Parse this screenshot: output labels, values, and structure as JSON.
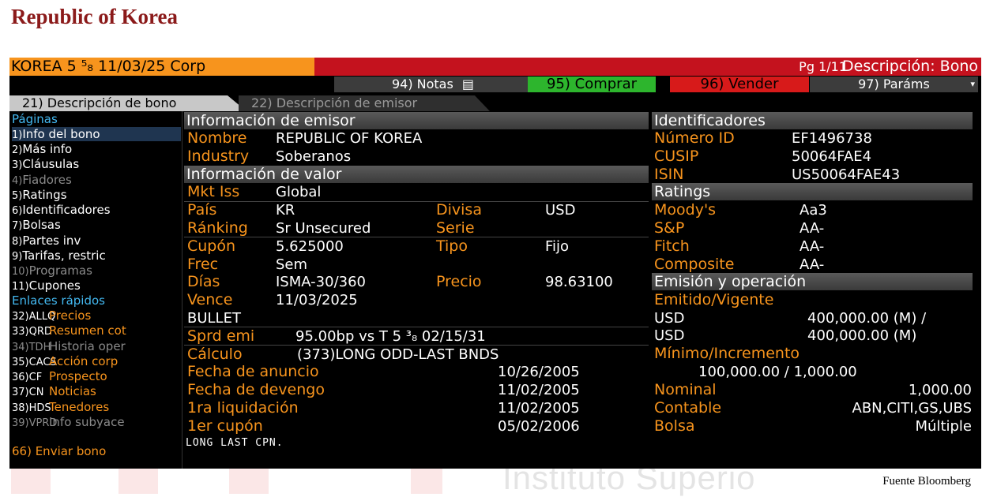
{
  "slide": {
    "title": "Republic of Korea",
    "source": "Fuente Bloomberg",
    "watermark": "Instituto Superio"
  },
  "header": {
    "security": "KOREA 5 ⁵₈ 11/03/25 Corp",
    "page": "Pg 1/11",
    "screen_title": "Descripción: Bono",
    "colors": {
      "orange": "#f7941d",
      "red_bar": "#c4121e",
      "green": "#2db52d",
      "sell_red": "#d71a1a"
    }
  },
  "toolbar": {
    "notes": "94) Notas",
    "buy": "95) Comprar",
    "sell": "96) Vender",
    "params": "97) Paráms",
    "params_arrow": "▾",
    "notes_icon": "document-icon"
  },
  "tabs": [
    {
      "label": "21) Descripción de bono"
    },
    {
      "label": "22) Descripción de emisor"
    }
  ],
  "sidebar": {
    "pages_heading": "Páginas",
    "pages": [
      {
        "num": "1)",
        "label": "Info del bono"
      },
      {
        "num": "2)",
        "label": "Más info"
      },
      {
        "num": "3)",
        "label": "Cláusulas"
      },
      {
        "num": "4)",
        "label": "Fiadores"
      },
      {
        "num": "5)",
        "label": "Ratings"
      },
      {
        "num": "6)",
        "label": "Identificadores"
      },
      {
        "num": "7)",
        "label": "Bolsas"
      },
      {
        "num": "8)",
        "label": "Partes inv"
      },
      {
        "num": "9)",
        "label": "Tarifas, restric"
      },
      {
        "num": "10)",
        "label": "Programas"
      },
      {
        "num": "11)",
        "label": "Cupones"
      }
    ],
    "links_heading": "Enlaces rápidos",
    "links": [
      {
        "code": "32)ALLQ",
        "label": "Precios"
      },
      {
        "code": "33)QRD",
        "label": "Resumen cot"
      },
      {
        "code": "34)TDH",
        "label": "Historia oper"
      },
      {
        "code": "35)CACS",
        "label": "Acción corp"
      },
      {
        "code": "36)CF",
        "label": "Prospecto"
      },
      {
        "code": "37)CN",
        "label": "Noticias"
      },
      {
        "code": "38)HDS",
        "label": "Tenedores"
      },
      {
        "code": "39)VPRD",
        "label": "Info subyace"
      }
    ],
    "send": "66) Enviar bono"
  },
  "issuer": {
    "heading": "Información de emisor",
    "name_label": "Nombre",
    "name": "REPUBLIC OF KOREA",
    "industry_label": "Industry",
    "industry": "Soberanos"
  },
  "security_info": {
    "heading": "Información de valor",
    "mkt_label": "Mkt Iss",
    "mkt": "Global",
    "country_label": "País",
    "country": "KR",
    "currency_label": "Divisa",
    "currency": "USD",
    "rank_label": "Ránking",
    "rank": "Sr Unsecured",
    "series_label": "Serie",
    "coupon_label": "Cupón",
    "coupon": "5.625000",
    "type_label": "Tipo",
    "type": "Fijo",
    "freq_label": "Frec",
    "freq": "Sem",
    "days_label": "Días",
    "days": "ISMA-30/360",
    "price_label": "Precio",
    "price": "98.63100",
    "maturity_label": "Vence",
    "maturity": "11/03/2025",
    "bullet": "BULLET",
    "spread_label": "Sprd emi",
    "spread": "95.00bp vs T 5 ³₈ 02/15/31",
    "calc_label": "Cálculo",
    "calc": "(373)LONG ODD-LAST BNDS",
    "announce_label": "Fecha de anuncio",
    "announce": "10/26/2005",
    "accrual_label": "Fecha de devengo",
    "accrual": "11/02/2005",
    "settle_label": "1ra liquidación",
    "settle": "11/02/2005",
    "first_coupon_label": "1er cupón",
    "first_coupon": "05/02/2006",
    "note": "LONG LAST CPN."
  },
  "identifiers": {
    "heading": "Identificadores",
    "id_label": "Número ID",
    "id": "EF1496738",
    "cusip_label": "CUSIP",
    "cusip": "50064FAE4",
    "isin_label": "ISIN",
    "isin": "US50064FAE43"
  },
  "ratings": {
    "heading": "Ratings",
    "moodys_label": "Moody's",
    "moodys": "Aa3",
    "sp_label": "S&P",
    "sp": "AA-",
    "fitch_label": "Fitch",
    "fitch": "AA-",
    "composite_label": "Composite",
    "composite": "AA-"
  },
  "issuance": {
    "heading": "Emisión y operación",
    "issued_label": "Emitido/Vigente",
    "issued_ccy": "USD",
    "issued_amt": "400,000.00 (M) /",
    "out_ccy": "USD",
    "out_amt": "400,000.00 (M)",
    "min_label": "Mínimo/Incremento",
    "min": "100,000.00 / 1,000.00",
    "par_label": "Nominal",
    "par": "1,000.00",
    "agent_label": "Contable",
    "agent": "ABN,CITI,GS,UBS",
    "exchange_label": "Bolsa",
    "exchange": "Múltiple"
  }
}
